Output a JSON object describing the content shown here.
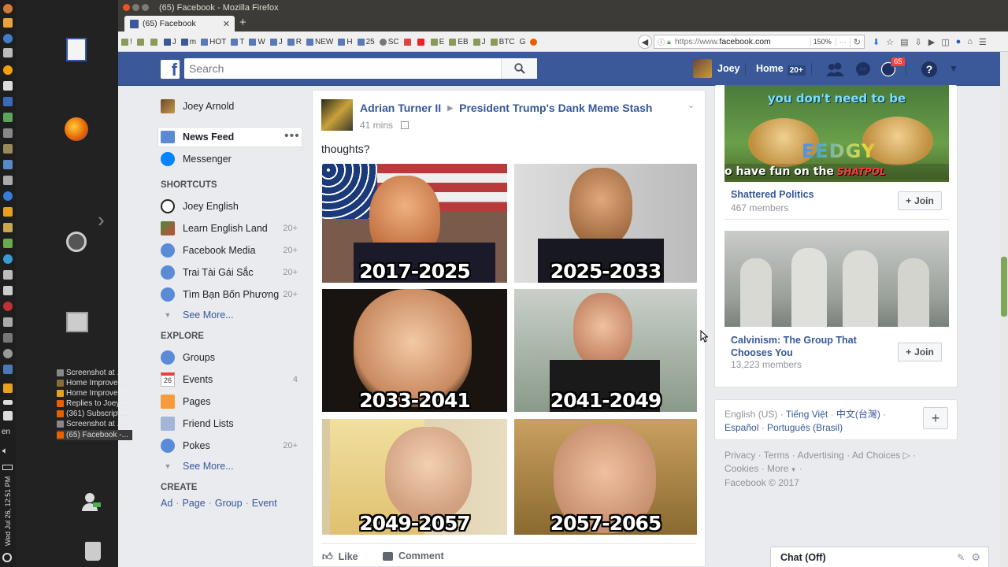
{
  "colors": {
    "fb_blue": "#3b5998",
    "link": "#365899",
    "badge": "#fa3e3e"
  },
  "desktop": {
    "clock": "Wed Jul 26, 12:51 PM",
    "lang": "en",
    "taskbar_items": [
      "Screenshot at ...",
      "Home Improve...",
      "Home Improve...",
      "Replies to Joey...",
      "(361) Subscript...",
      "Screenshot at ...",
      "(65) Facebook -..."
    ]
  },
  "browser": {
    "window_title": "(65) Facebook - Mozilla Firefox",
    "tab_title": "(65) Facebook",
    "url_prefix": "https://www.",
    "url_domain": "facebook.com",
    "zoom": "150%",
    "bookmarks": [
      "!",
      "",
      "",
      "J",
      "m",
      "HOT",
      "T",
      "W",
      "J",
      "R",
      "NEW",
      "H",
      "25",
      "SC",
      "",
      "",
      "E",
      "EB",
      "J",
      "BTC",
      "G"
    ]
  },
  "fb": {
    "search_placeholder": "Search",
    "user_name": "Joey",
    "home_label": "Home",
    "home_badge": "20+",
    "notif_badge": "65"
  },
  "left_nav": {
    "profile": "Joey Arnold",
    "news_feed": "News Feed",
    "messenger": "Messenger",
    "shortcuts_title": "SHORTCUTS",
    "shortcuts": [
      {
        "label": "Joey English",
        "count": ""
      },
      {
        "label": "Learn English Land",
        "count": "20+"
      },
      {
        "label": "Facebook Media",
        "count": "20+"
      },
      {
        "label": "Trai Tài Gái Sắc",
        "count": "20+"
      },
      {
        "label": "Tìm Bạn Bốn Phương",
        "count": "20+"
      }
    ],
    "see_more_1": "See More...",
    "explore_title": "EXPLORE",
    "explore": [
      {
        "label": "Groups",
        "count": ""
      },
      {
        "label": "Events",
        "count": "4"
      },
      {
        "label": "Pages",
        "count": ""
      },
      {
        "label": "Friend Lists",
        "count": ""
      },
      {
        "label": "Pokes",
        "count": "20+"
      }
    ],
    "events_day": "26",
    "see_more_2": "See More...",
    "create_title": "CREATE",
    "create_links": [
      "Ad",
      "Page",
      "Group",
      "Event"
    ]
  },
  "post": {
    "author": "Adrian Turner II",
    "group": "President Trump's Dank Meme Stash",
    "time": "41 mins",
    "text": "thoughts?",
    "captions": [
      "2017-2025",
      "2025-2033",
      "2033-2041",
      "2041-2049",
      "2049-2057",
      "2057-2065"
    ],
    "like": "Like",
    "comment": "Comment"
  },
  "right_col": {
    "meme_line1": "you don't need to be",
    "meme_word": "EEDGY",
    "meme_line2": "o have fun on the",
    "meme_brand": "SHATPOL",
    "group1": {
      "name": "Shattered Politics",
      "members": "467 members"
    },
    "group2": {
      "name": "Calvinism: The Group That Chooses You",
      "members": "13,223 members"
    },
    "join_label": "Join",
    "languages": [
      "English (US)",
      "Tiếng Việt",
      "中文(台灣)",
      "Español",
      "Português (Brasil)"
    ],
    "footer_links": [
      "Privacy",
      "Terms",
      "Advertising",
      "Ad Choices",
      "Cookies",
      "More"
    ],
    "copyright": "Facebook © 2017",
    "chat": "Chat (Off)"
  }
}
